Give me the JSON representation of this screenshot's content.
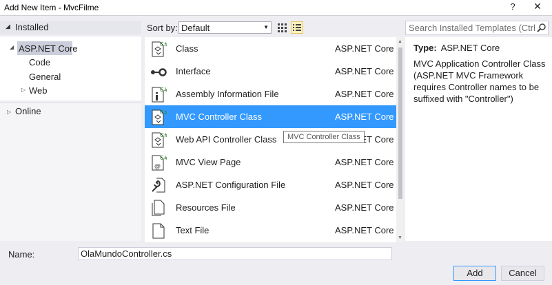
{
  "window": {
    "title": "Add New Item - MvcFilme",
    "help": "?",
    "close": "✕"
  },
  "left_pane": {
    "header": "Installed",
    "tree": [
      {
        "label": "ASP.NET Core",
        "expanded": true
      },
      {
        "label": "Code"
      },
      {
        "label": "General"
      },
      {
        "label": "Web"
      }
    ],
    "online": "Online"
  },
  "toolbar": {
    "sort_label": "Sort by:",
    "sort_value": "Default"
  },
  "search": {
    "placeholder": "Search Installed Templates (Ctrl+E)"
  },
  "templates": [
    {
      "name": "Class",
      "lang": "ASP.NET Core",
      "icon": "csharp-class-icon"
    },
    {
      "name": "Interface",
      "lang": "ASP.NET Core",
      "icon": "interface-icon"
    },
    {
      "name": "Assembly Information File",
      "lang": "ASP.NET Core",
      "icon": "assembly-info-icon"
    },
    {
      "name": "MVC Controller Class",
      "lang": "ASP.NET Core",
      "icon": "csharp-class-icon",
      "selected": true
    },
    {
      "name": "Web API Controller Class",
      "lang": "ASP.NET Core",
      "icon": "csharp-class-icon"
    },
    {
      "name": "MVC View Page",
      "lang": "ASP.NET Core",
      "icon": "view-page-icon"
    },
    {
      "name": "ASP.NET Configuration File",
      "lang": "ASP.NET Core",
      "icon": "config-file-icon"
    },
    {
      "name": "Resources File",
      "lang": "ASP.NET Core",
      "icon": "resources-file-icon"
    },
    {
      "name": "Text File",
      "lang": "ASP.NET Core",
      "icon": "text-file-icon"
    }
  ],
  "tooltip": "MVC Controller Class",
  "details": {
    "type_label": "Type:",
    "type_value": "ASP.NET Core",
    "description": "MVC Application Controller Class (ASP.NET MVC Framework requires Controller names to be suffixed with \"Controller\")"
  },
  "footer": {
    "name_label": "Name:",
    "name_value": "OlaMundoController.cs",
    "add": "Add",
    "cancel": "Cancel"
  },
  "colors": {
    "selection": "#3399ff",
    "accent_border": "#3399ff"
  }
}
